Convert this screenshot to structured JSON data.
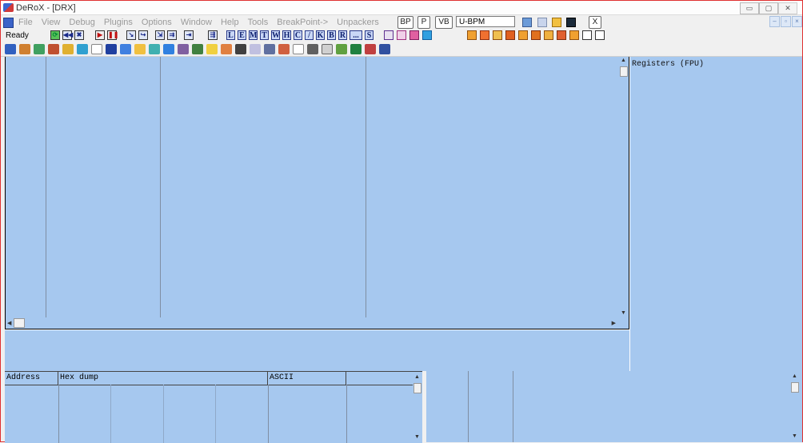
{
  "window": {
    "title": "DeRoX - [DRX]",
    "controls": [
      "▭",
      "▢",
      "✕"
    ]
  },
  "menubar": {
    "items": [
      "File",
      "View",
      "Debug",
      "Plugins",
      "Options",
      "Window",
      "Help",
      "Tools",
      "BreakPoint->",
      "Unpackers"
    ],
    "breakpoint_buttons": [
      "BP",
      "P",
      "VB"
    ],
    "ubpm_label": "U-BPM",
    "close_label": "X",
    "mdi_controls": [
      "–",
      "▫",
      "×"
    ]
  },
  "toolbar": {
    "status": "Ready",
    "letter_buttons": [
      "L",
      "E",
      "M",
      "T",
      "W",
      "H",
      "C",
      "/",
      "K",
      "B",
      "R",
      "...",
      "S"
    ]
  },
  "disassembly": {
    "scroll_up": "▲",
    "scroll_down": "▼",
    "scroll_left": "◀",
    "scroll_right": "▶"
  },
  "registers": {
    "title": "Registers (FPU)"
  },
  "dump": {
    "headers": [
      "Address",
      "Hex dump",
      "ASCII"
    ],
    "scroll_up": "▲",
    "scroll_down": "▼"
  },
  "stack": {
    "scroll_up": "▲",
    "scroll_down": "▼"
  },
  "colors": {
    "pane_bg": "#a6c8ef",
    "frame_border": "#e03030"
  }
}
